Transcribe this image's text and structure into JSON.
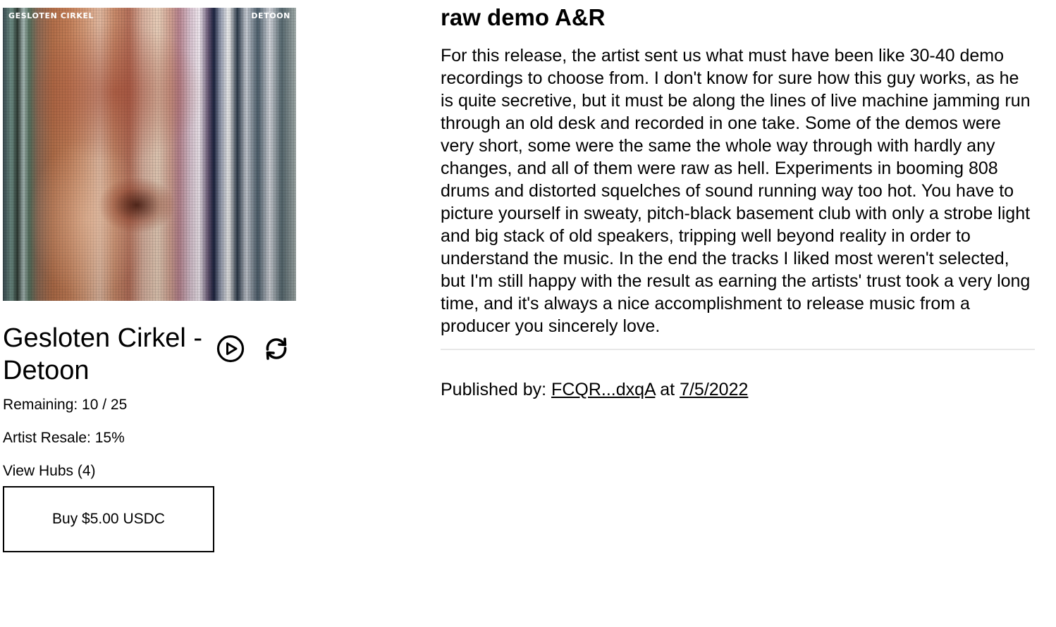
{
  "release": {
    "cover": {
      "text_left": "GESLOTEN CIRKEL",
      "text_right": "DETOON"
    },
    "title": "Gesloten Cirkel - Detoon",
    "remaining": "Remaining: 10 / 25",
    "artist_resale": "Artist Resale: 15%",
    "view_hubs": "View Hubs (4)",
    "buy_label": "Buy $5.00 USDC"
  },
  "icons": {
    "play": "play-circle-icon",
    "repeat": "repeat-icon"
  },
  "description": {
    "title": "raw demo A&R",
    "body": "For this release, the artist sent us what must have been like 30-40 demo recordings to choose from. I don't know for sure how this guy works, as he is quite secretive, but it must be along the lines of live machine jamming run through an old desk and recorded in one take. Some of the demos were very short, some were the same the whole way through with hardly any changes, and all of them were raw as hell. Experiments in booming 808 drums and distorted squelches of sound running way too hot. You have to picture yourself in sweaty, pitch-black basement club with only a strobe light and big stack of old speakers, tripping well beyond reality in order to understand the music. In the end the tracks I liked most weren't selected, but I'm still happy with the result as earning the artists' trust took a very long time, and it's always a nice accomplishment to release music from a producer you sincerely love."
  },
  "published": {
    "prefix": "Published by: ",
    "publisher": "FCQR...dxqA",
    "middle": " at ",
    "date": "7/5/2022"
  },
  "colors": {
    "text": "#000000",
    "divider": "#e8e8e8",
    "background": "#ffffff"
  }
}
